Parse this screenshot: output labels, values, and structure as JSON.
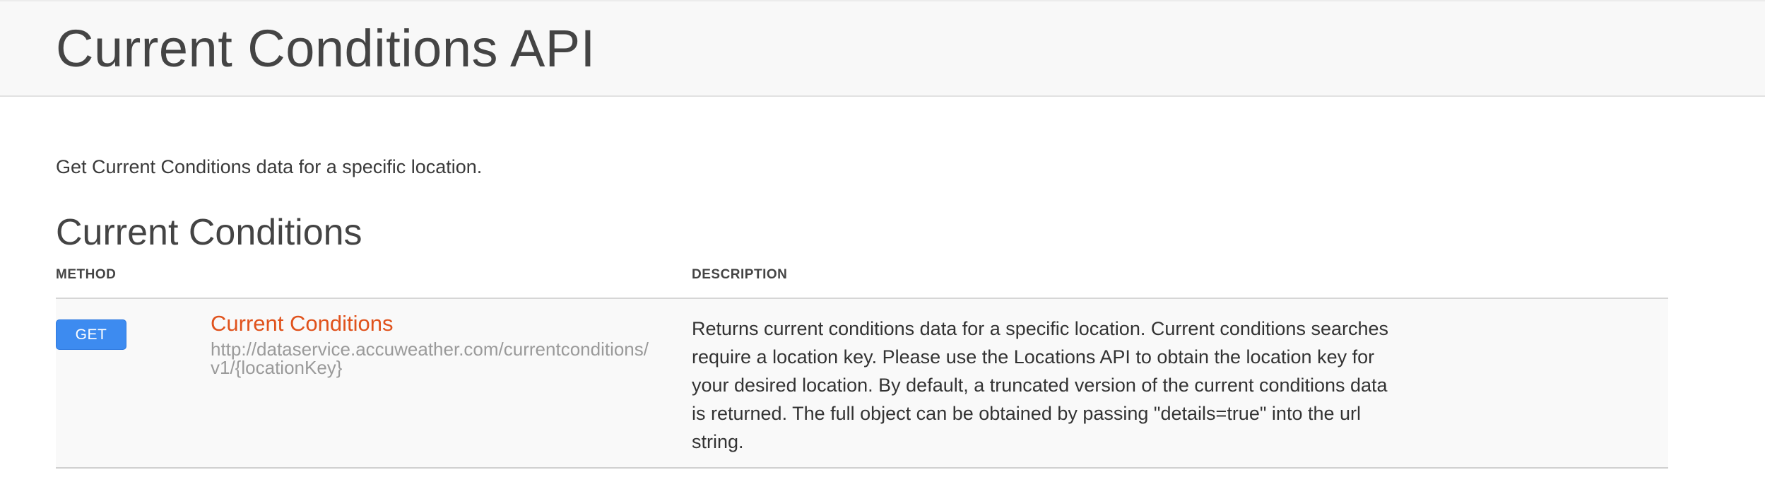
{
  "header": {
    "title": "Current Conditions API"
  },
  "intro": {
    "text": "Get Current Conditions data for a specific location."
  },
  "section": {
    "title": "Current Conditions"
  },
  "table": {
    "columns": {
      "method": "METHOD",
      "description": "DESCRIPTION"
    },
    "rows": [
      {
        "method": "GET",
        "name": "Current Conditions",
        "url": "http://dataservice.accuweather.com/currentconditions/v1/{locationKey}",
        "description": "Returns current conditions data for a specific location. Current conditions searches require a location key. Please use the Locations API to obtain the location key for your desired location. By default, a truncated version of the current conditions data is returned. The full object can be obtained by passing \"details=true\" into the url string."
      }
    ]
  },
  "colors": {
    "method_button": "#3d8bf0",
    "endpoint_link": "#e0521c",
    "url_text": "#9a9a9a",
    "header_bg": "#f8f8f8"
  }
}
